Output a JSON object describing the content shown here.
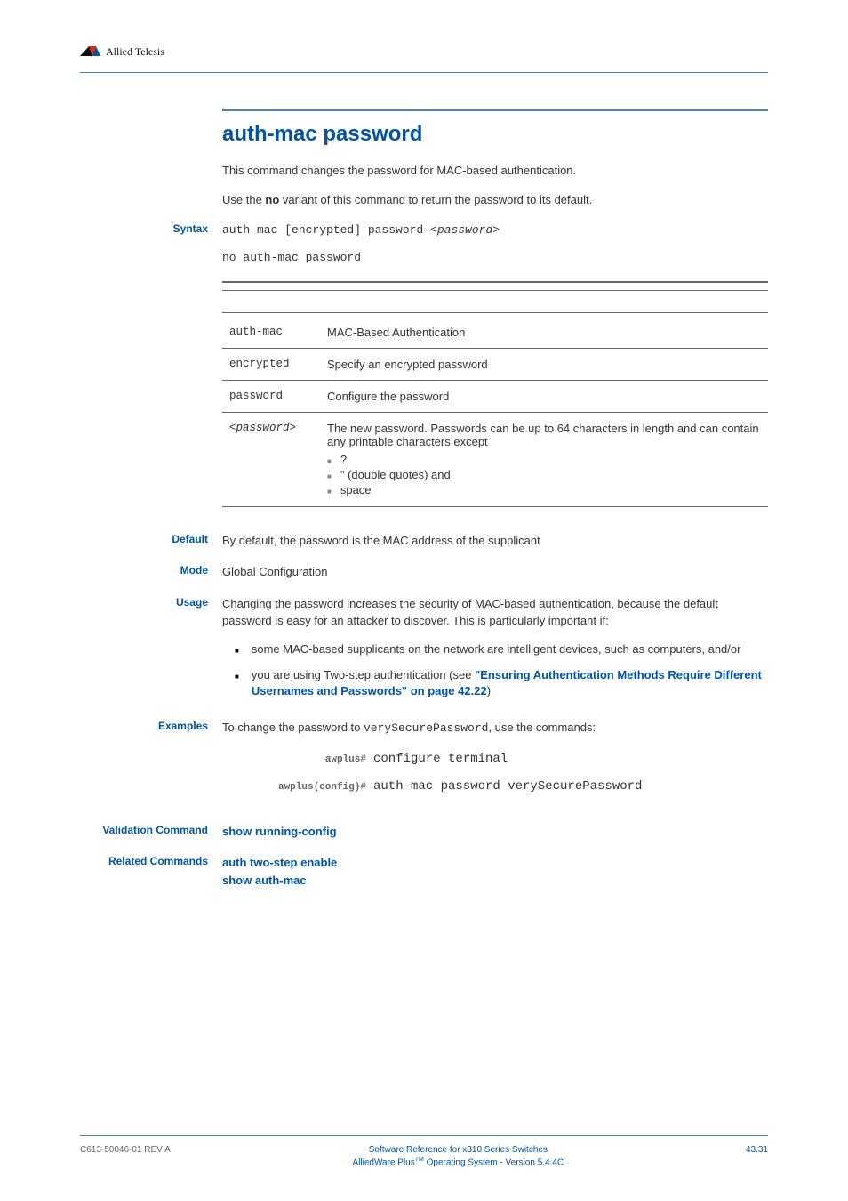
{
  "header": {
    "brand": "Allied Telesis"
  },
  "title": "auth-mac password",
  "intro": {
    "p1": "This command changes the password for MAC-based authentication.",
    "p2_pre": "Use the ",
    "p2_bold": "no",
    "p2_post": " variant of this command to return the password to its default."
  },
  "labels": {
    "syntax": "Syntax",
    "default": "Default",
    "mode": "Mode",
    "usage": "Usage",
    "examples": "Examples",
    "validation": "Validation Command",
    "related": "Related Commands"
  },
  "syntax": {
    "line1_a": "auth-mac [encrypted] password <",
    "line1_b": "password",
    "line1_c": ">",
    "line2": "no auth-mac password"
  },
  "params": [
    {
      "key": "auth-mac",
      "desc": "MAC-Based Authentication"
    },
    {
      "key": "encrypted",
      "desc": "Specify an encrypted password"
    },
    {
      "key": "password",
      "desc": "Configure the password"
    }
  ],
  "param4": {
    "key": "<password>",
    "desc": "The new password. Passwords can be up to 64 characters in length and can contain any printable characters except",
    "b1": "?",
    "b2": "\" (double quotes) and",
    "b3": "space"
  },
  "default_text": "By default, the password is the MAC address of the supplicant",
  "mode_text": "Global Configuration",
  "usage": {
    "p1": "Changing the password increases the security of MAC-based authentication, because the default password is easy for an attacker to discover. This is particularly important if:",
    "b1": "some MAC-based supplicants on the network are intelligent devices, such as computers, and/or",
    "b2_pre": "you are using Two-step authentication (see ",
    "b2_link": "\"Ensuring Authentication Methods Require Different Usernames and Passwords\" on page 42.22",
    "b2_post": ")"
  },
  "examples": {
    "intro_a": "To change the password to ",
    "intro_b": "verySecurePassword",
    "intro_c": ", use the commands:",
    "prompt1": "awplus#",
    "cmd1": "configure terminal",
    "prompt2": "awplus(config)#",
    "cmd2": "auth-mac password verySecurePassword"
  },
  "validation_link": "show running-config",
  "related_links": {
    "l1": "auth two-step enable",
    "l2": "show auth-mac"
  },
  "footer": {
    "left": "C613-50046-01 REV A",
    "center1": "Software Reference for x310 Series Switches",
    "center2a": "AlliedWare Plus",
    "center2b": " Operating System - Version 5.4.4C",
    "tm": "TM",
    "right": "43.31"
  }
}
